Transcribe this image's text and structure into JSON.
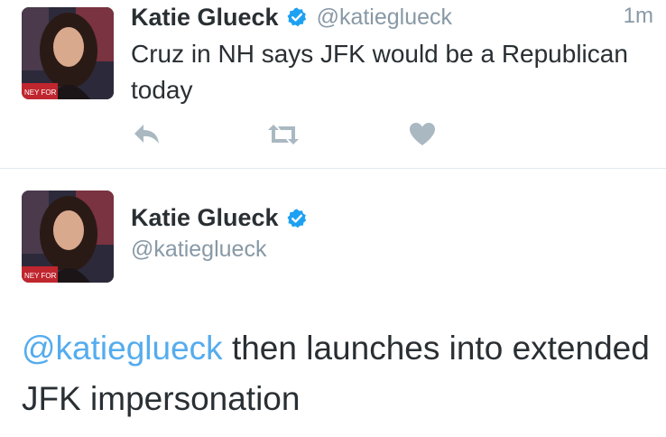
{
  "tweet1": {
    "author_name": "Katie Glueck",
    "handle": "@katieglueck",
    "timestamp": "1m",
    "text": "Cruz in NH says JFK would be a Republican today",
    "avatar_caption": "NEY FOR",
    "actions": [
      "reply",
      "retweet",
      "like"
    ]
  },
  "tweet2": {
    "author_name": "Katie Glueck",
    "handle": "@katieglueck",
    "avatar_caption": "NEY FOR",
    "mention": "@katieglueck",
    "text_rest": " then launches into extended JFK impersonation"
  },
  "colors": {
    "text": "#292f33",
    "secondary": "#8899a6",
    "link": "#55acee",
    "verified": "#1da1f2",
    "action_icons": "#aab8c2",
    "divider": "#e1e8ed"
  },
  "icons": {
    "verified": "verified-badge-icon",
    "reply": "reply-arrow-icon",
    "retweet": "retweet-icon",
    "like": "heart-icon"
  }
}
